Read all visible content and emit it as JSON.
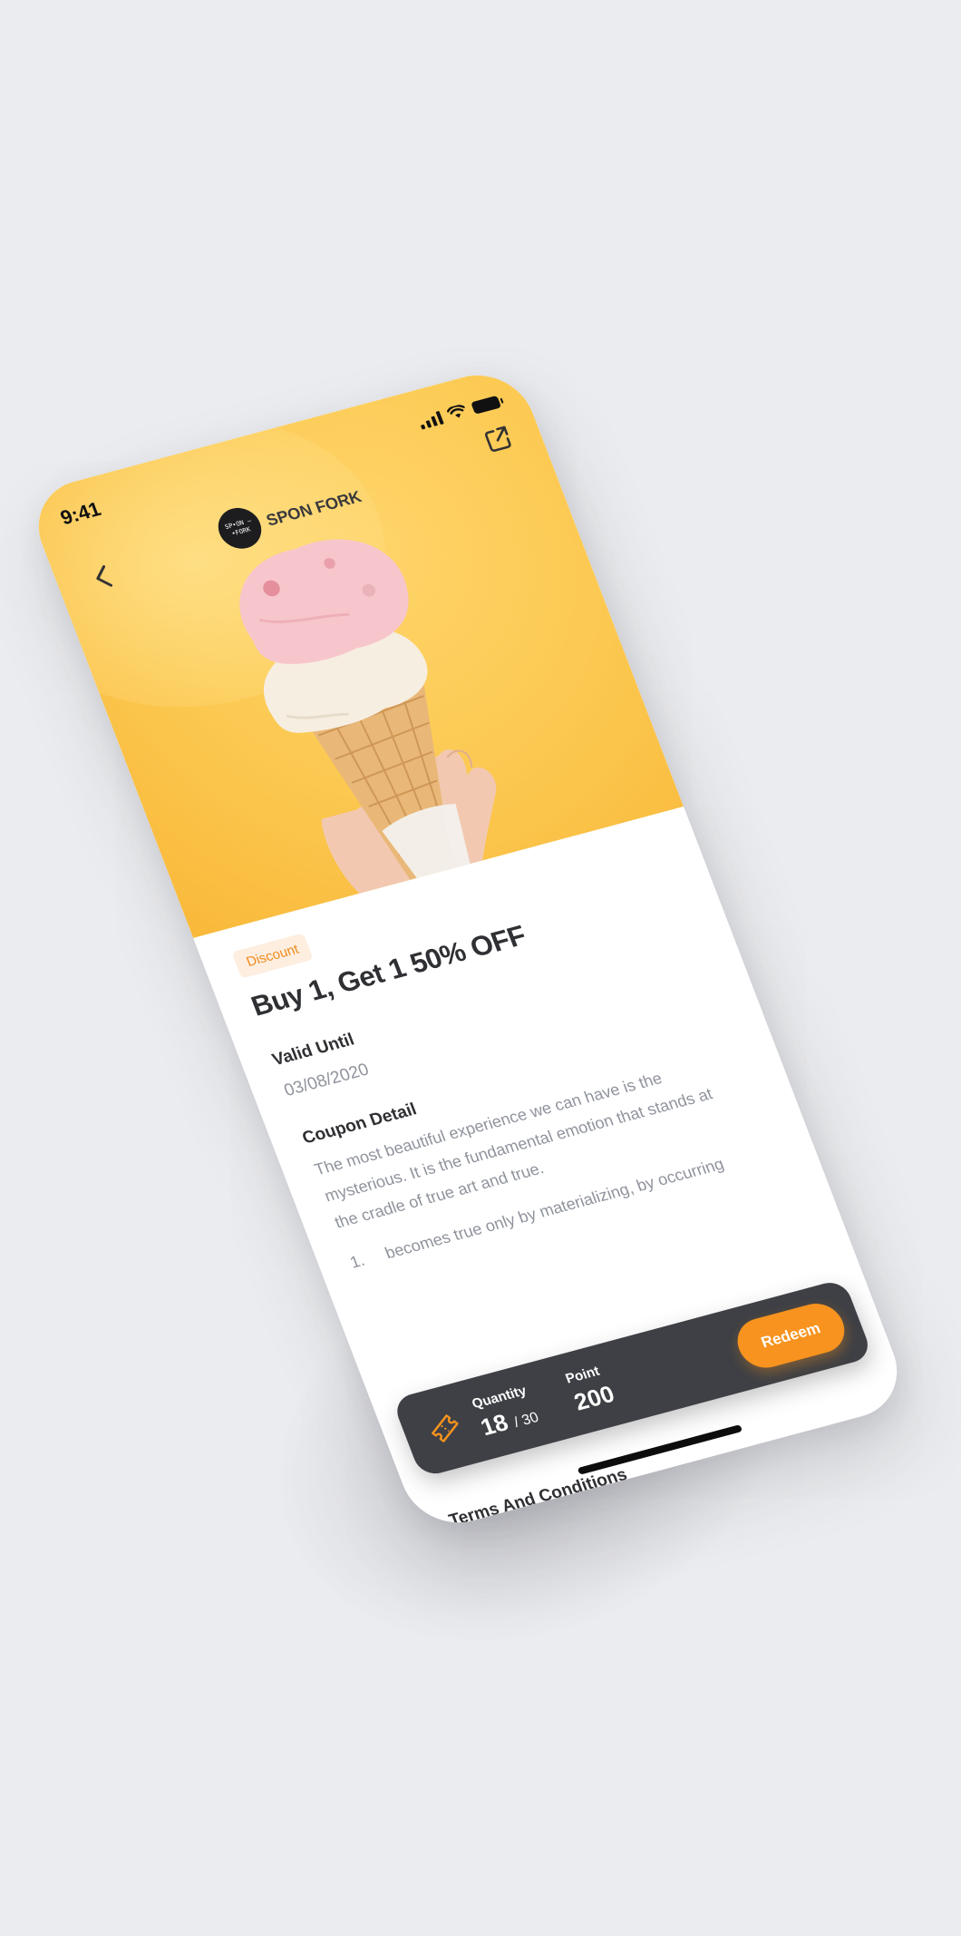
{
  "status_bar": {
    "time": "9:41"
  },
  "header": {
    "back_icon": "chevron-left-icon",
    "brand_logo_text": "SP•ON — •FORK",
    "brand_name": "SPON FORK",
    "share_icon": "share-external-icon"
  },
  "hero": {
    "image": "ice-cream-cone"
  },
  "coupon": {
    "badge": "Discount",
    "title": "Buy 1, Get 1 50% OFF",
    "valid_label": "Valid Until",
    "valid_date": "03/08/2020",
    "detail_label": "Coupon Detail",
    "detail_text": "The most beautiful experience we can have is the mysterious. It is the fundamental emotion that stands at the cradle of true art and true.",
    "list": [
      {
        "num": "1.",
        "text": "becomes true only by materializing, by occurring"
      }
    ],
    "terms_label": "Terms And Conditions"
  },
  "bottom_bar": {
    "icon": "ticket-icon",
    "quantity_label": "Quantity",
    "quantity_value": "18",
    "quantity_total": "/ 30",
    "point_label": "Point",
    "point_value": "200",
    "redeem_label": "Redeem"
  },
  "colors": {
    "accent": "#f7931e",
    "hero_yellow": "#fccb55",
    "dark_bar": "#3e4045",
    "text_primary": "#2f3033",
    "text_muted": "#8f939c",
    "badge_bg": "#fdeee0"
  }
}
